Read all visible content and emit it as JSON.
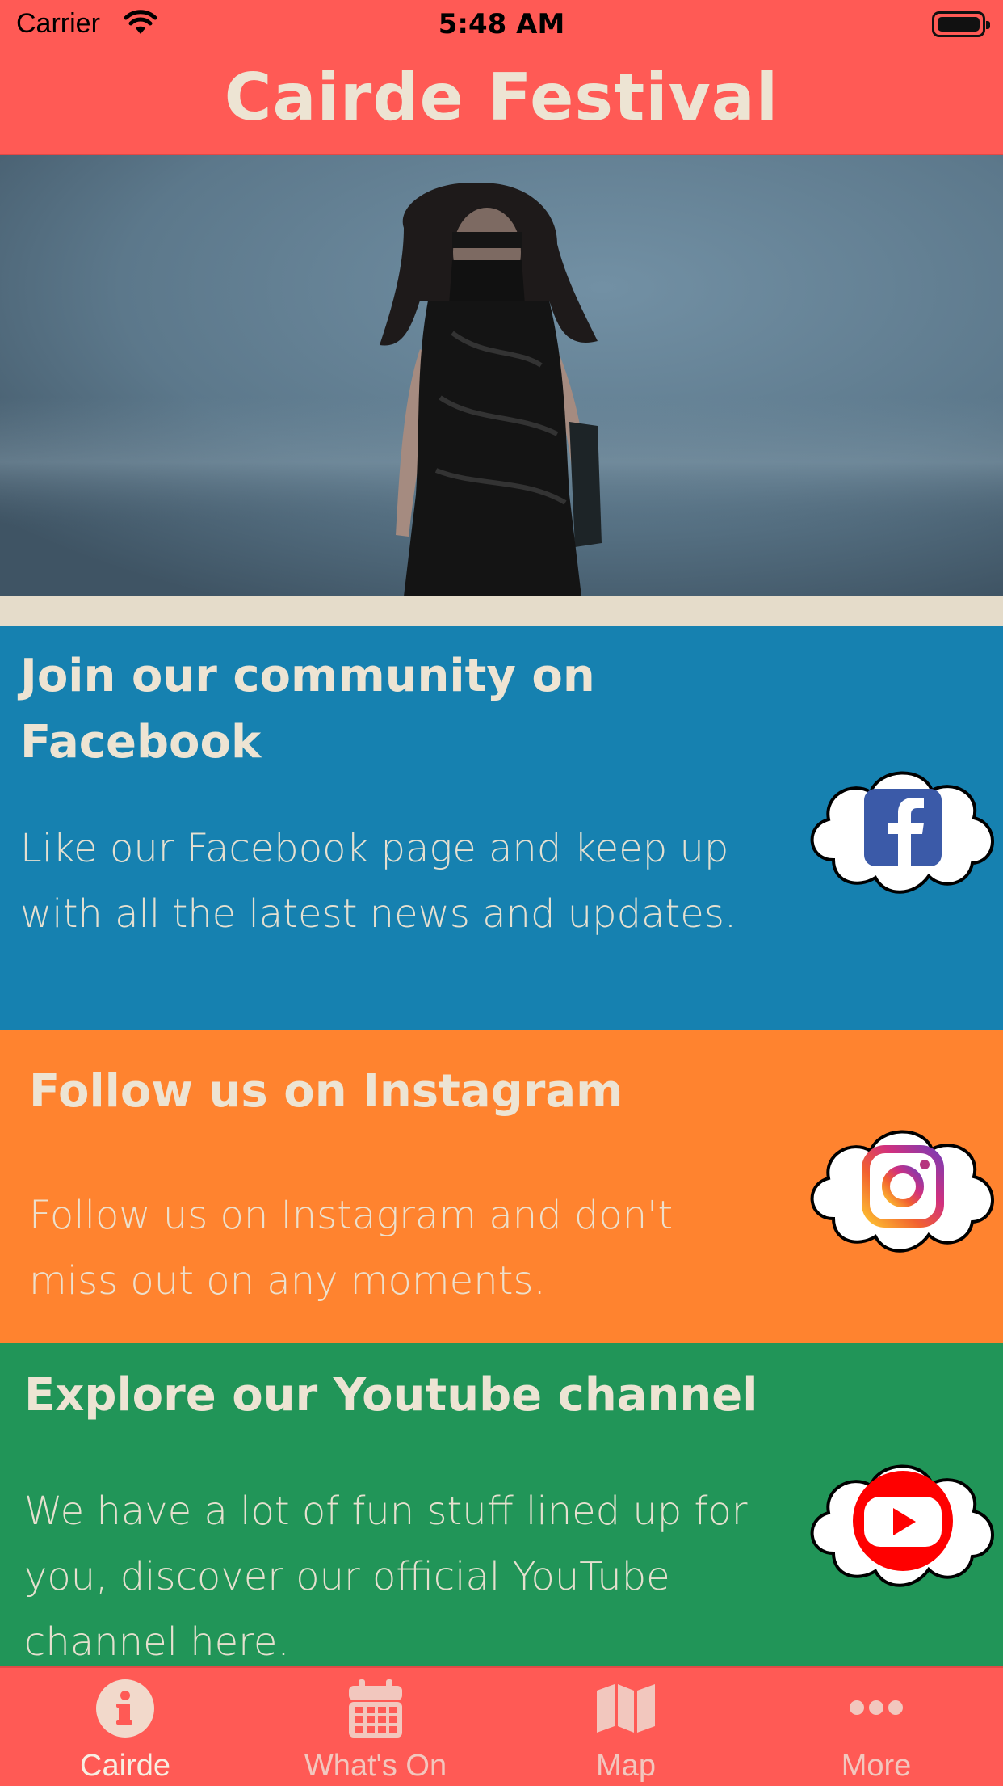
{
  "status_bar": {
    "carrier": "Carrier",
    "time": "5:48 AM"
  },
  "nav": {
    "title": "Cairde Festival"
  },
  "hero": {
    "description_icon": "hero-photo"
  },
  "cards": [
    {
      "id": "facebook",
      "title": "Join our community on Facebook",
      "description": "Like our Facebook page and keep up with all the latest news and updates.",
      "icon": "facebook-icon",
      "color": "#1681B0"
    },
    {
      "id": "instagram",
      "title": "Follow us on Instagram",
      "description": "Follow us on Instagram and don't miss out on any moments.",
      "icon": "instagram-icon",
      "color": "#FF832F"
    },
    {
      "id": "youtube",
      "title": "Explore our Youtube channel",
      "description": "We have a lot of fun stuff lined up for you, discover our official YouTube channel here.",
      "icon": "youtube-icon",
      "color": "#219558"
    }
  ],
  "tabs": [
    {
      "label": "Cairde",
      "icon": "info-icon",
      "active": true
    },
    {
      "label": "What's On",
      "icon": "calendar-icon",
      "active": false
    },
    {
      "label": "Map",
      "icon": "map-icon",
      "active": false
    },
    {
      "label": "More",
      "icon": "more-icon",
      "active": false
    }
  ],
  "colors": {
    "brand": "#FF5A55",
    "text_cream": "#EDE4D3"
  }
}
